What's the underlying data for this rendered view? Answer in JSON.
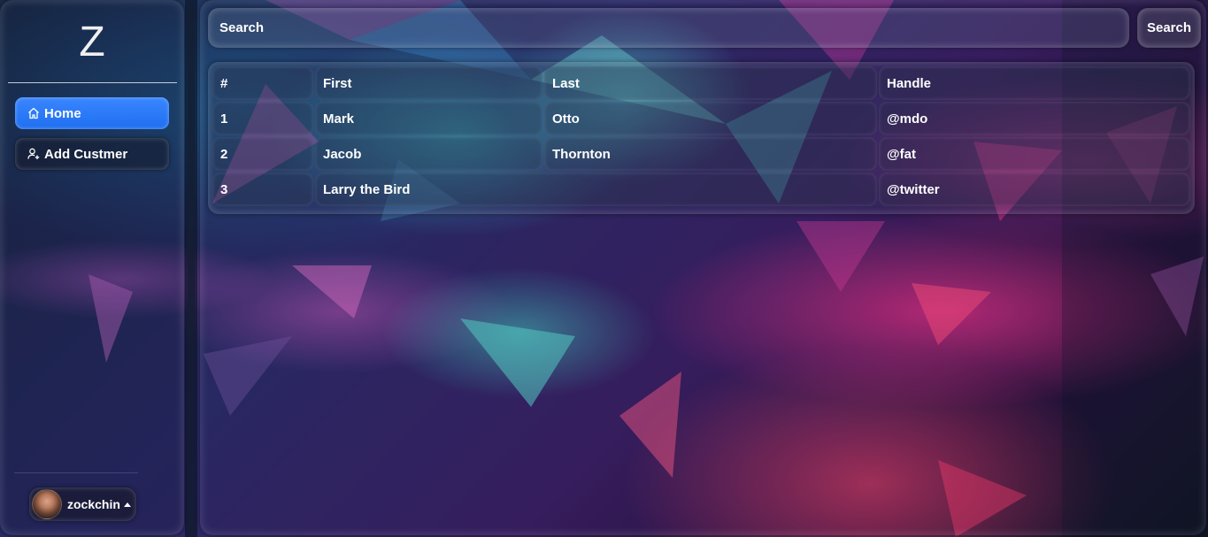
{
  "sidebar": {
    "logo": "Z",
    "nav": [
      {
        "label": "Home",
        "icon": "home-icon",
        "active": true
      },
      {
        "label": "Add Custmer",
        "icon": "add-user-icon",
        "active": false
      }
    ],
    "user": {
      "name": "zockchin",
      "avatar_icon": "avatar-photo"
    }
  },
  "search": {
    "placeholder": "Search",
    "button_label": "Search"
  },
  "table": {
    "headers": [
      "#",
      "First",
      "Last",
      "Handle"
    ],
    "rows": [
      [
        "1",
        "Mark",
        "Otto",
        "@mdo"
      ],
      [
        "2",
        "Jacob",
        "Thornton",
        "@fat"
      ],
      [
        "3",
        "Larry the Bird",
        "",
        "@twitter"
      ]
    ]
  },
  "colors": {
    "accent": "#2a7cf8",
    "text": "#ffffff"
  }
}
